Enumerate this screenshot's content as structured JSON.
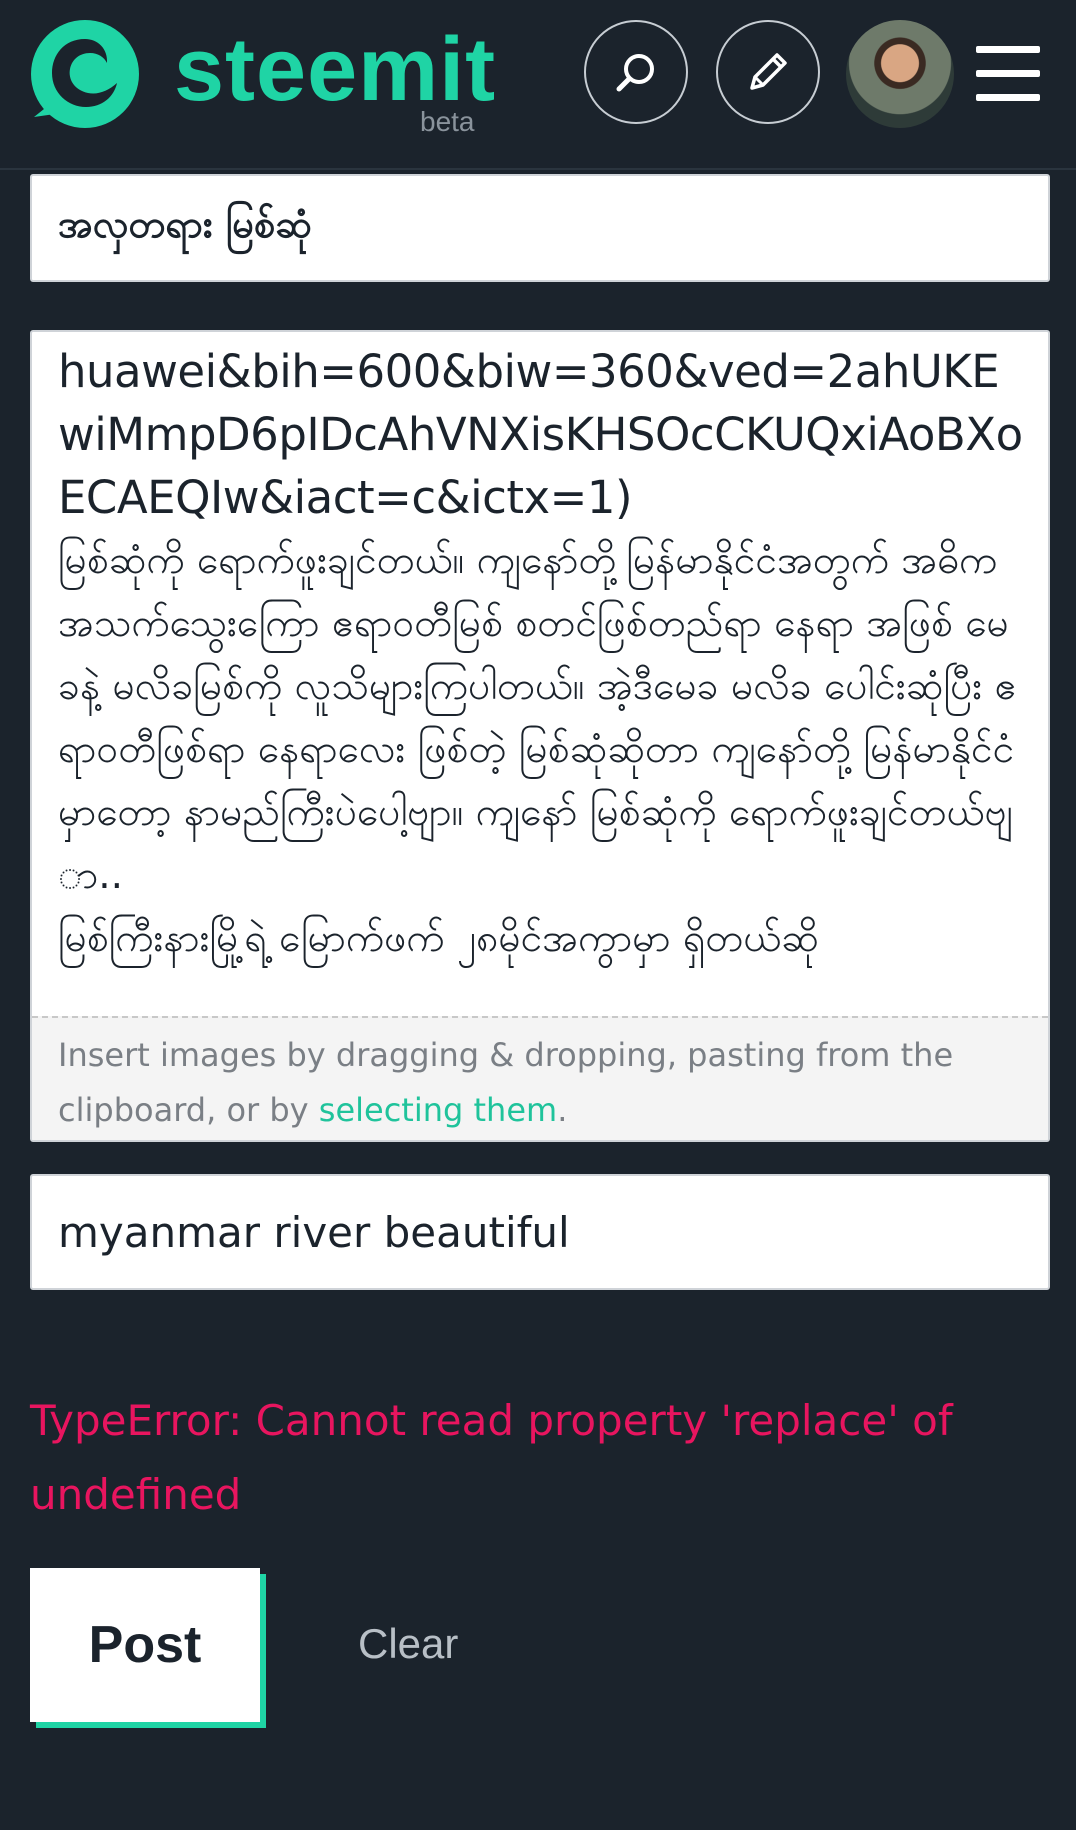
{
  "header": {
    "logo_text": "steemit",
    "logo_badge": "beta",
    "icons": {
      "logo": "steemit-logo-icon",
      "search": "search-icon",
      "compose": "pencil-icon",
      "avatar": "user-avatar",
      "menu": "hamburger-menu-icon"
    },
    "brand_color": "#1fd4a5"
  },
  "editor": {
    "title_value": "အလှတရား မြစ်ဆုံ",
    "body_url_fragment": "huawei&bih=600&biw=360&ved=2ahUKEwiMmpD6pIDcAhVNXisKHSOcCKUQxiAoBXoECAEQIw&iact=c&ictx=1)",
    "body_paragraph": "မြစ်ဆုံကို ရောက်ဖူးချင်တယ်။ ကျနော်တို့မြန်မာနိုင်ငံအတွက် အဓိက အသက်သွေးကြော ဧရာဝတီမြစ် စတင်ဖြစ်တည်ရာ နေရာ အဖြစ် မေခနဲ့ မလိခမြစ်ကို လူသိများကြပါတယ်။ အဲ့ဒီမေခ မလိခ ပေါင်းဆုံပြီး ဧရာဝတီဖြစ်ရာ နေရာလေး ဖြစ်တဲ့ မြစ်ဆုံဆိုတာ ကျနော်တို့ မြန်မာနိုင်ငံမှာတော့ နာမည်ကြီးပဲပေါ့ဗျာ။ ကျနော် မြစ်ဆုံကို ရောက်ဖူးချင်တယ်ဗျာ..",
    "body_cut_line": "မြစ်ကြီးနားမြို့ရဲ့ မြောက်ဖက် ၂၈မိုင်အကွာမှာ ရှိတယ်ဆို",
    "dropzone_text": "Insert images by dragging & dropping, pasting from the clipboard, or by ",
    "dropzone_link": "selecting them",
    "dropzone_end": ".",
    "tags_value": "myanmar river beautiful"
  },
  "error": {
    "message": "TypeError: Cannot read property 'replace' of undefined",
    "color": "#e8155f"
  },
  "actions": {
    "post_label": "Post",
    "clear_label": "Clear"
  }
}
